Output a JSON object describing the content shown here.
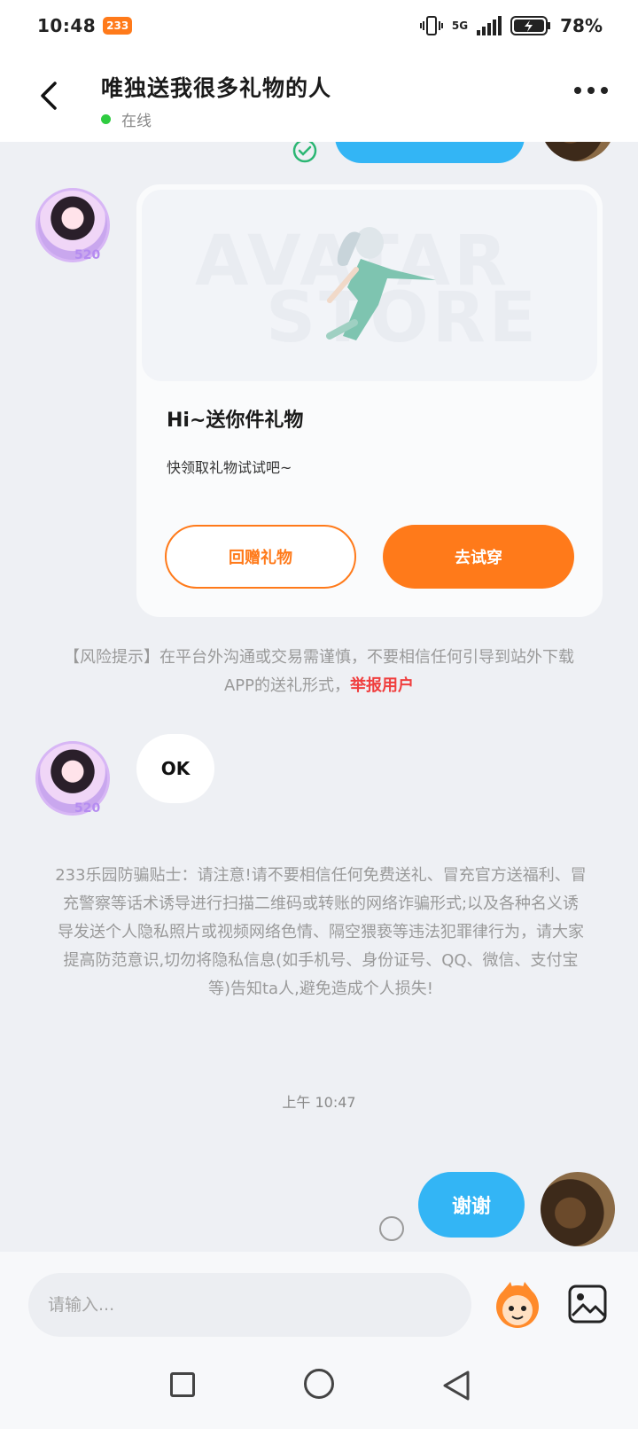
{
  "status_bar": {
    "time": "10:48",
    "app_badge": "233",
    "network": "5G",
    "battery": "78%"
  },
  "header": {
    "title": "唯独送我很多礼物的人",
    "online_status": "在线"
  },
  "messages": {
    "gift_card": {
      "banner_watermark_1": "AVATAR",
      "banner_watermark_2": "STORE",
      "title": "Hi~送你件礼物",
      "subtitle": "快领取礼物试试吧~",
      "return_gift_label": "回赠礼物",
      "try_on_label": "去试穿"
    },
    "avatar_badge": "520",
    "risk_notice": {
      "text": "【风险提示】在平台外沟通或交易需谨慎，不要相信任何引导到站外下载APP的送礼形式，",
      "report_label": "举报用户"
    },
    "ok_message": "OK",
    "safety_tips": "233乐园防骗贴士：请注意!请不要相信任何免费送礼、冒充官方送福利、冒充警察等话术诱导进行扫描二维码或转账的网络诈骗形式;以及各种名义诱导发送个人隐私照片或视频网络色情、隔空猥亵等违法犯罪律行为，请大家提高防范意识,切勿将隐私信息(如手机号、身份证号、QQ、微信、支付宝等)告知ta人,避免造成个人损失!",
    "timestamp": "上午 10:47",
    "thanks_message": "谢谢"
  },
  "input_bar": {
    "placeholder": "请输入..."
  },
  "colors": {
    "accent_orange": "#ff7a1a",
    "bubble_blue": "#33b5f5",
    "online_green": "#2ecc40",
    "report_red": "#f03e3e"
  }
}
